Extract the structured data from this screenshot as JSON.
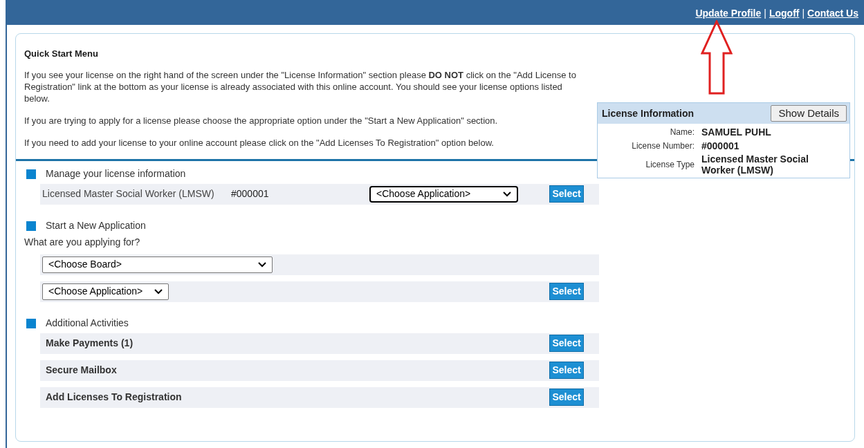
{
  "header": {
    "links": [
      "Update Profile",
      "Logoff",
      "Contact Us"
    ],
    "separator": "|"
  },
  "quick_start": {
    "title": "Quick Start Menu",
    "paragraphs": [
      "If you see your license on the right hand of the screen under the \"License Information\" section please **DO NOT** click on the \"Add License to Registration\" link at the bottom as your license is already associated with this online account. You should see your license options listed below.",
      "If you are trying to apply for a license please choose the appropriate option under the \"Start a New Application\" section.",
      "If you need to add your license to your online account please click on the \"Add Licenses To Registration\" option below."
    ]
  },
  "license_info": {
    "title": "License Information",
    "button": "Show Details",
    "fields": [
      {
        "label": "Name:",
        "value": "SAMUEL PUHL"
      },
      {
        "label": "License Number:",
        "value": "#000001"
      },
      {
        "label": "License Type",
        "value": "Licensed Master Social Worker (LMSW)"
      }
    ]
  },
  "sections": [
    {
      "title": "Manage your license information",
      "rows": [
        {
          "kind": "license",
          "name": "Licensed Master Social Worker (LMSW)",
          "number": "#000001",
          "dropdown": {
            "value": "<Choose Application>",
            "focused": true
          },
          "button": "Select"
        }
      ]
    },
    {
      "title": "Start a New Application",
      "prompt": "What are you applying for?",
      "rows": [
        {
          "kind": "dropdown",
          "dropdown": {
            "value": "<Choose Board>",
            "focused": false
          }
        },
        {
          "kind": "dropdown",
          "dropdown": {
            "value": "<Choose Application>",
            "focused": false
          },
          "button": "Select"
        }
      ]
    },
    {
      "title": "Additional Activities",
      "rows": [
        {
          "kind": "activity",
          "label": "Make Payments (1)",
          "button": "Select"
        },
        {
          "kind": "activity",
          "label": "Secure Mailbox",
          "button": "Select"
        },
        {
          "kind": "activity",
          "label": "Add Licenses To Registration",
          "button": "Select"
        }
      ]
    }
  ]
}
